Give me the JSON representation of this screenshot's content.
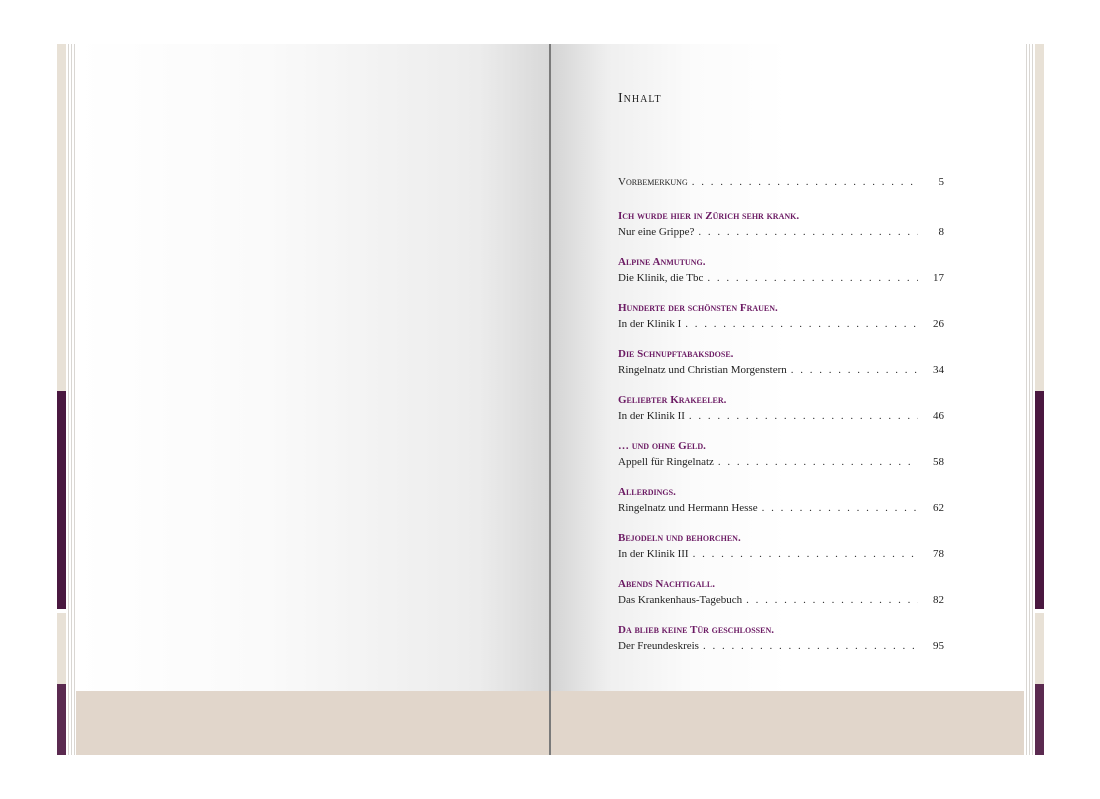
{
  "toc": {
    "title": "Inhalt",
    "intro": {
      "label": "Vorbemerkung",
      "page": "5"
    },
    "chapters": [
      {
        "title": "Ich wurde hier in Zürich sehr krank.",
        "subtitle": "Nur eine Grippe?",
        "page": "8"
      },
      {
        "title": "Alpine Anmutung.",
        "subtitle": "Die Klinik, die Tbc",
        "page": "17"
      },
      {
        "title": "Hunderte der schönsten Frauen.",
        "subtitle": "In der Klinik I",
        "page": "26"
      },
      {
        "title": "Die Schnupftabaksdose.",
        "subtitle": "Ringelnatz und Christian Morgenstern",
        "page": "34"
      },
      {
        "title": "Geliebter Krakeeler.",
        "subtitle": "In der Klinik II",
        "page": "46"
      },
      {
        "title": "… und ohne Geld.",
        "subtitle": "Appell für Ringelnatz",
        "page": "58"
      },
      {
        "title": "Allerdings.",
        "subtitle": "Ringelnatz und Hermann Hesse",
        "page": "62"
      },
      {
        "title": "Bejodeln und behorchen.",
        "subtitle": "In der Klinik III",
        "page": "78"
      },
      {
        "title": "Abends Nachtigall.",
        "subtitle": "Das Krankenhaus-Tagebuch",
        "page": "82"
      },
      {
        "title": "Da blieb keine Tür geschlossen.",
        "subtitle": "Der Freundeskreis",
        "page": "95"
      }
    ]
  },
  "colors": {
    "accent": "#6b1a63",
    "cover_purple": "#4a1840",
    "band": "#e1d6cb"
  }
}
